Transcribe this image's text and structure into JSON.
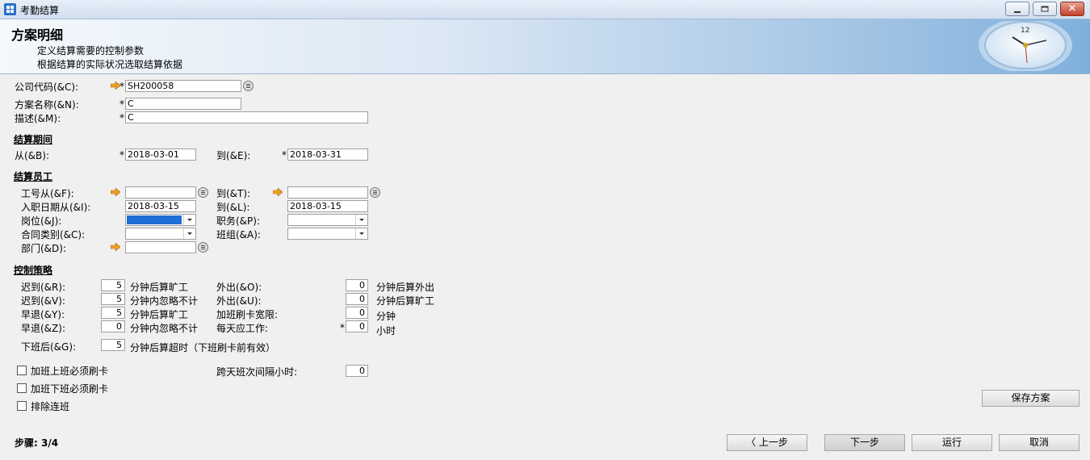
{
  "window": {
    "title": "考勤结算"
  },
  "banner": {
    "title": "方案明细",
    "subtitle1": "定义结算需要的控制参数",
    "subtitle2": "根据结算的实际状况选取结算依据"
  },
  "general": {
    "company_code_label": "公司代码(&C):",
    "company_code_value": "SH200058",
    "plan_name_label": "方案名称(&N):",
    "plan_name_value": "C",
    "description_label": "描述(&M):",
    "description_value": "C"
  },
  "period": {
    "heading": "结算期间",
    "from_label": "从(&B):",
    "from_value": "2018-03-01",
    "to_label": "到(&E):",
    "to_value": "2018-03-31"
  },
  "employees": {
    "heading": "结算员工",
    "emp_from_label": "工号从(&F):",
    "emp_to_label": "到(&T):",
    "hire_from_label": "入职日期从(&I):",
    "hire_from_value": "2018-03-15",
    "hire_to_label": "到(&L):",
    "hire_to_value": "2018-03-15",
    "position_label": "岗位(&J):",
    "duty_label": "职务(&P):",
    "contract_label": "合同类别(&C):",
    "team_label": "班组(&A):",
    "dept_label": "部门(&D):"
  },
  "control": {
    "heading": "控制策略",
    "late1_label": "迟到(&R):",
    "late1_value": "5",
    "late1_unit": "分钟后算旷工",
    "late2_label": "迟到(&V):",
    "late2_value": "5",
    "late2_unit": "分钟内忽略不计",
    "early1_label": "早退(&Y):",
    "early1_value": "5",
    "early1_unit": "分钟后算旷工",
    "early2_label": "早退(&Z):",
    "early2_value": "0",
    "early2_unit": "分钟内忽略不计",
    "out1_label": "外出(&O):",
    "out1_value": "0",
    "out1_unit": "分钟后算外出",
    "out2_label": "外出(&U):",
    "out2_value": "0",
    "out2_unit": "分钟后算旷工",
    "ot_grace_label": "加班刷卡宽限:",
    "ot_grace_value": "0",
    "ot_grace_unit": "分钟",
    "daily_work_label": "每天应工作:",
    "daily_work_value": "0",
    "daily_work_unit": "小时",
    "after_work_label": "下班后(&G):",
    "after_work_value": "5",
    "after_work_unit": "分钟后算超时（下班刷卡前有效）",
    "cross_day_label": "跨天班次间隔小时:",
    "cross_day_value": "0"
  },
  "options": {
    "ot_start_swipe": "加班上班必须刷卡",
    "ot_end_swipe": "加班下班必须刷卡",
    "exclude_consecutive": "排除连班"
  },
  "buttons": {
    "save_plan": "保存方案",
    "prev": "上一步",
    "next": "下一步",
    "run": "运行",
    "cancel": "取消"
  },
  "footer": {
    "step": "步骤: 3/4"
  },
  "colors": {
    "selected_combo": "#1e6fd6",
    "arrow": "#f0a020"
  }
}
